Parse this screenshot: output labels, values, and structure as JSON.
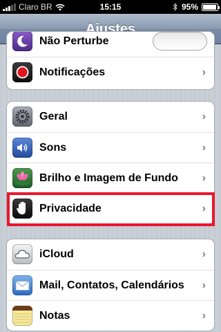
{
  "status_bar": {
    "carrier": "Claro BR",
    "time": "15:15",
    "battery": "95%",
    "signal_icon": "signal-bars-icon",
    "wifi_icon": "wifi-icon",
    "bluetooth_icon": "bluetooth-icon",
    "battery_level": 0.95
  },
  "nav": {
    "title": "Ajustes"
  },
  "groups": [
    {
      "items": [
        {
          "label": "Não Perturbe",
          "icon": "moon-icon",
          "control": "toggle"
        },
        {
          "label": "Notificações",
          "icon": "notifications-icon"
        }
      ]
    },
    {
      "items": [
        {
          "label": "Geral",
          "icon": "gear-icon"
        },
        {
          "label": "Sons",
          "icon": "speaker-icon"
        },
        {
          "label": "Brilho e Imagem de Fundo",
          "icon": "flower-icon"
        },
        {
          "label": "Privacidade",
          "icon": "hand-icon"
        }
      ]
    },
    {
      "items": [
        {
          "label": "iCloud",
          "icon": "cloud-icon"
        },
        {
          "label": "Mail, Contatos, Calendários",
          "icon": "mail-icon"
        },
        {
          "label": "Notas",
          "icon": "notes-icon"
        }
      ]
    }
  ],
  "chevron": "›",
  "colors": {
    "highlight": "#e8172e",
    "nav_bar": "#6d83a1",
    "background": "#c5ccd4"
  }
}
